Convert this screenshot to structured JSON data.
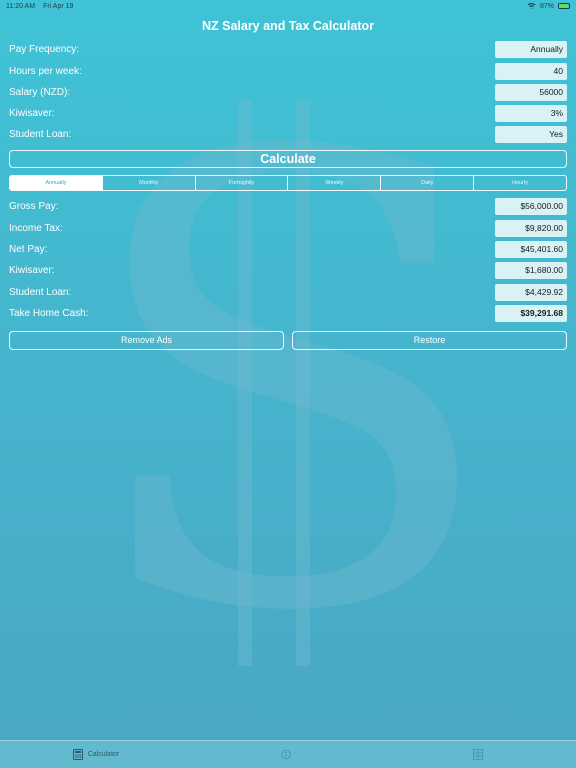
{
  "status_bar": {
    "time": "11:20 AM",
    "date": "Fri Apr 19",
    "battery": "87%",
    "battery_level": 0.87
  },
  "header": {
    "title": "NZ Salary and Tax Calculator"
  },
  "inputs": [
    {
      "label": "Pay Frequency:",
      "value": "Annually"
    },
    {
      "label": "Hours per week:",
      "value": "40"
    },
    {
      "label": "Salary (NZD):",
      "value": "56000"
    },
    {
      "label": "Kiwisaver:",
      "value": "3%"
    },
    {
      "label": "Student Loan:",
      "value": "Yes"
    }
  ],
  "calculate_label": "Calculate",
  "period_tabs": [
    "Annually",
    "Monthly",
    "Fortnightly",
    "Weekly",
    "Daily",
    "Hourly"
  ],
  "selected_period": "Annually",
  "results": [
    {
      "label": "Gross Pay:",
      "value": "$56,000.00"
    },
    {
      "label": "Income Tax:",
      "value": "$9,820.00"
    },
    {
      "label": "Net Pay:",
      "value": "$45,401.60"
    },
    {
      "label": "Kiwisaver:",
      "value": "$1,680.00"
    },
    {
      "label": "Student Loan:",
      "value": "$4,429.92"
    },
    {
      "label": "Take Home Cash:",
      "value": "$39,291.68"
    }
  ],
  "buttons": {
    "remove_ads": "Remove Ads",
    "restore": "Restore"
  },
  "tab_bar": [
    {
      "label": "Calculator",
      "icon": "calculator-icon"
    },
    {
      "label": "",
      "icon": "info-icon"
    },
    {
      "label": "",
      "icon": "table-icon"
    }
  ]
}
